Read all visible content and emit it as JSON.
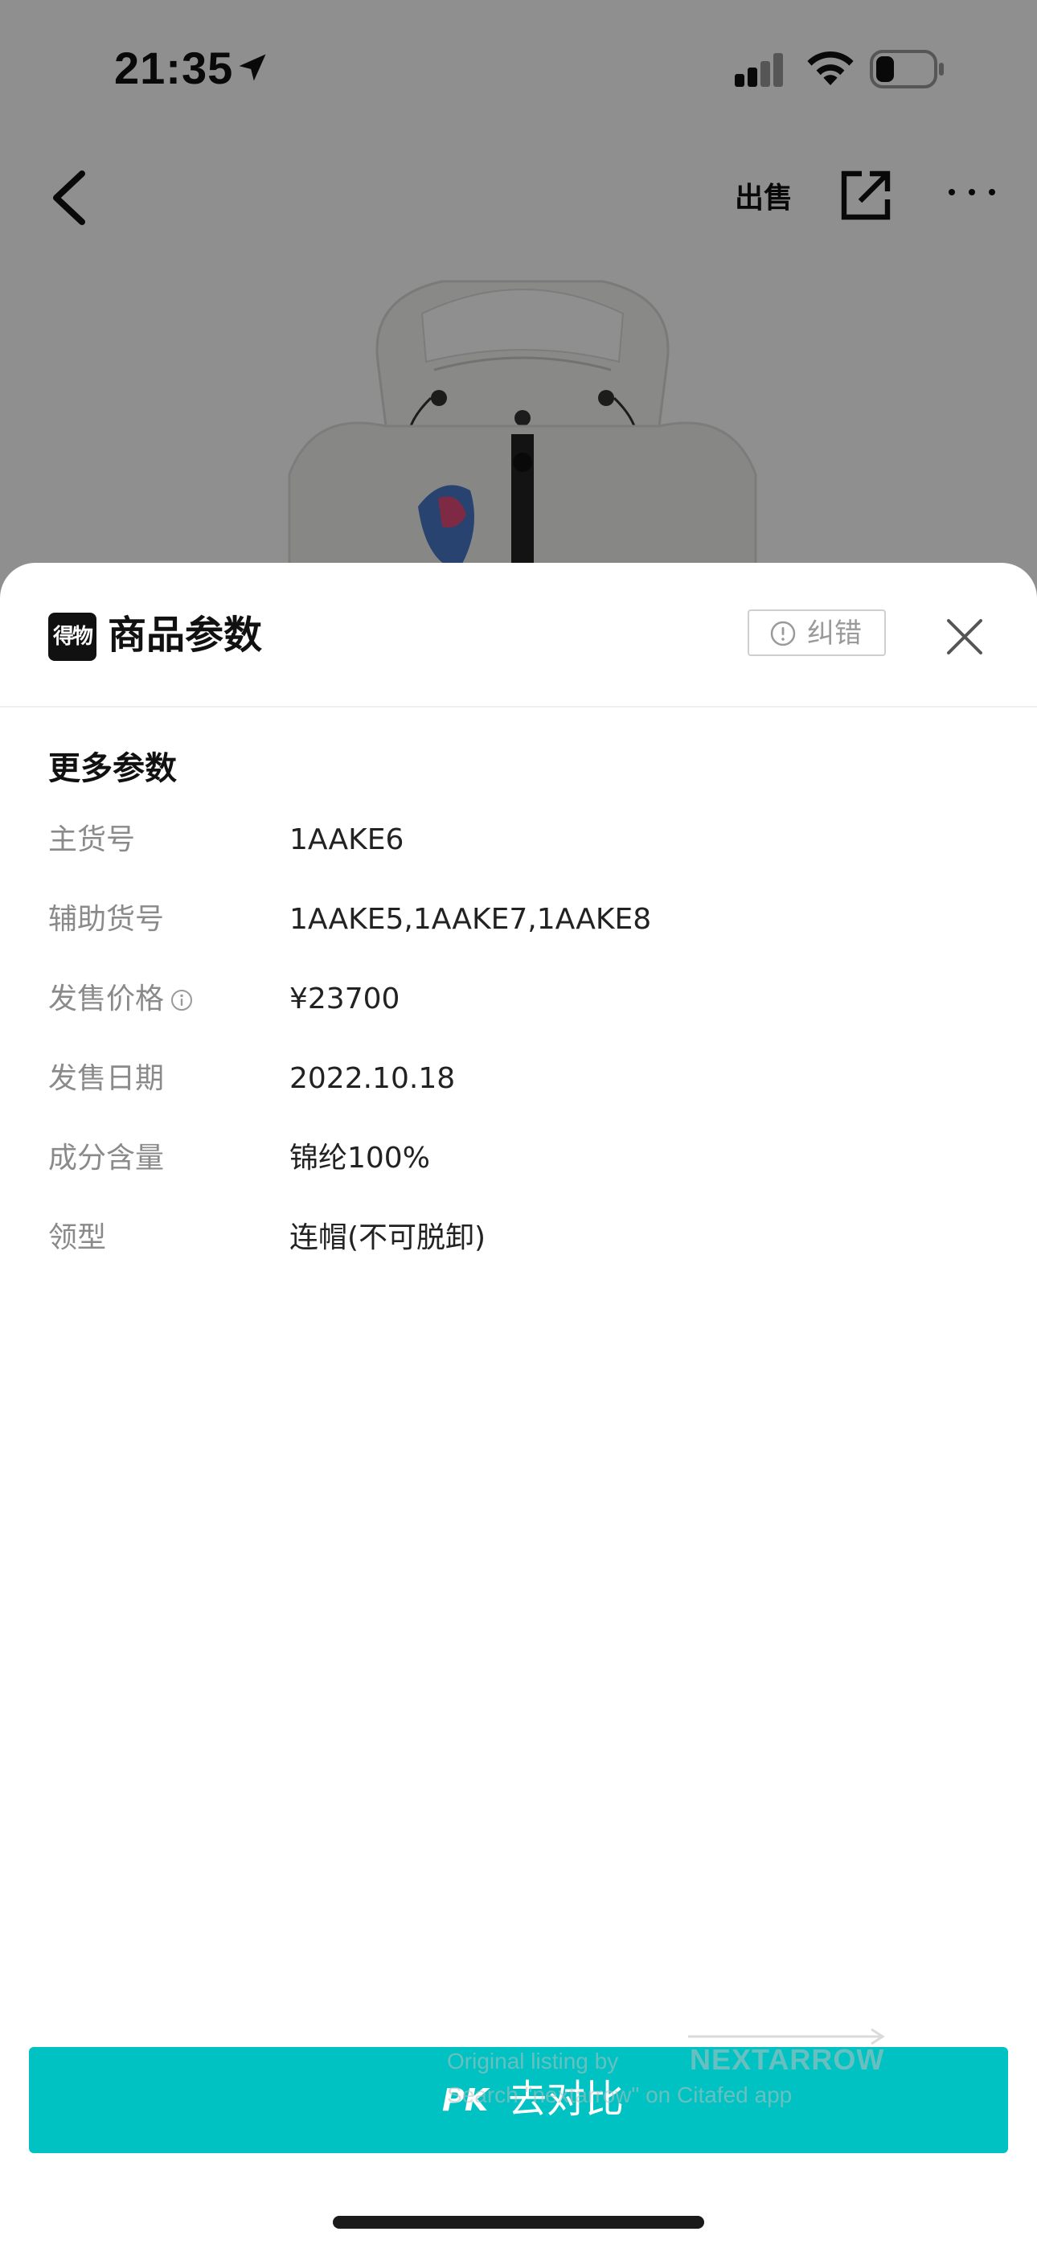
{
  "status_bar": {
    "time": "21:35",
    "icons": [
      "location-arrow-icon",
      "cellular-signal-icon",
      "wifi-icon",
      "battery-icon"
    ]
  },
  "top_nav": {
    "sell_label": "出售",
    "icons": [
      "back-chevron-icon",
      "share-icon",
      "more-dots-icon"
    ]
  },
  "sheet": {
    "logo_text": "得物",
    "title": "商品参数",
    "report_label": "纠错",
    "section_title": "更多参数",
    "params": [
      {
        "label": "主货号",
        "value": "1AAKE6"
      },
      {
        "label": "辅助货号",
        "value": "1AAKE5,1AAKE7,1AAKE8"
      },
      {
        "label": "发售价格",
        "value": "¥23700"
      },
      {
        "label": "发售日期",
        "value": "2022.10.18"
      },
      {
        "label": "成分含量",
        "value": "锦纶100%"
      },
      {
        "label": "领型",
        "value": "连帽(不可脱卸)"
      }
    ]
  },
  "compare_button": {
    "pk_label": "PK",
    "label": "去对比"
  },
  "watermark": {
    "line1": "Original listing by",
    "brand": "NEXTARROW",
    "line2": "Search \"nextarrow\" on Citafed app"
  },
  "colors": {
    "accent": "#01c2c3",
    "overlay": "rgba(0,0,0,0.44)"
  }
}
